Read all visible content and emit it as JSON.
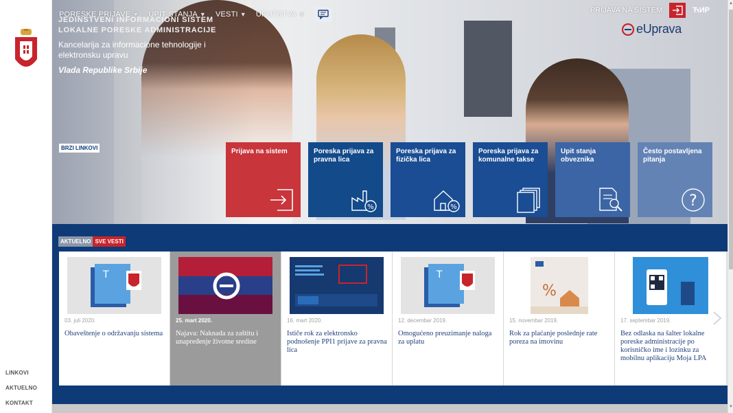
{
  "nav": {
    "items": [
      {
        "label": "PORESKE PRIJAVE",
        "caret": "▼"
      },
      {
        "label": "UPIT STANJA",
        "caret": "▼"
      },
      {
        "label": "VESTI",
        "caret": "▼"
      },
      {
        "label": "UPUTSTVA",
        "caret": "▼"
      }
    ]
  },
  "header": {
    "org_line1": "JEDINSTVENI INFORMACIONI SISTEM",
    "org_line2": "LOKALNE PORESKE ADMINISTRACIJE",
    "org_sub": "Kancelarija za informacione tehnologije i elektronsku upravu",
    "org_gov": "Vlada Republike Srbije",
    "login_label": "PRIJAVA NA SISTEM",
    "lang": "ЋИР",
    "brand": "eUprava"
  },
  "quick_links": {
    "label": "BRZI LINKOVI",
    "tiles": [
      {
        "label": "Prijava na sistem",
        "color": "#c8353b",
        "icon": "login-arrow-icon"
      },
      {
        "label": "Poreska prijava za pravna lica",
        "color": "#124a8a",
        "icon": "factory-percent-icon"
      },
      {
        "label": "Poreska prijava za fizička lica",
        "color": "#1a4d93",
        "icon": "house-percent-icon"
      },
      {
        "label": "Poreska prijava za komunalne takse",
        "color": "#1a4d93",
        "icon": "documents-stack-icon"
      },
      {
        "label": "Upit stanja obveznika",
        "color": "#3b65a4",
        "icon": "document-search-icon"
      },
      {
        "label": "Često postavljena pitanja",
        "color": "#6483b5",
        "icon": "question-circle-icon"
      }
    ]
  },
  "news": {
    "tab_current": "AKTUELNO",
    "tab_all": "SVE VESTI",
    "cards": [
      {
        "date": "03. juli 2020.",
        "title": "Obaveštenje o održavanju sistema",
        "thumb": "document-crest"
      },
      {
        "date": "25. mart 2020.",
        "title": "Najava: Naknada za zaštitu i unapređenje životne sredine",
        "thumb": "flag-logo"
      },
      {
        "date": "16. mart 2020.",
        "title": "Ističe rok za elektronsko podnošenje PPI1 prijave za pravna lica",
        "thumb": "poster"
      },
      {
        "date": "12. decembar 2019.",
        "title": "Omogućeno preuzimanje naloga za uplatu",
        "thumb": "document-crest"
      },
      {
        "date": "15. novembar 2019.",
        "title": "Rok za plaćanje poslednje rate poreza na imovinu",
        "thumb": "tax-house"
      },
      {
        "date": "17. septembar 2019.",
        "title": "Bez odlaska na šalter lokalne poreske administracije po korisničko ime i lozinku za mobilnu aplikaciju Moja LPA",
        "thumb": "mobile-app"
      }
    ]
  },
  "sidebar": {
    "links": [
      "LINKOVI",
      "AKTUELNO",
      "KONTAKT"
    ]
  }
}
